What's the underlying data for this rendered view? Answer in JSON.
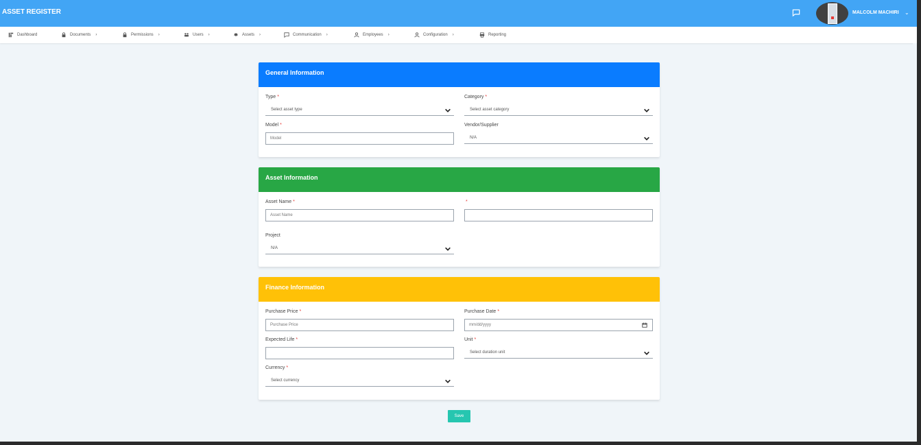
{
  "app": {
    "title": "ASSET REGISTER"
  },
  "topbar": {
    "chat_icon": "message-square-icon",
    "user_name": "MALCOLM MACHIRI",
    "user_caret": "⌄"
  },
  "nav": [
    {
      "label": "Dashboard",
      "icon": "dashboard-icon",
      "caret": ""
    },
    {
      "label": "Documents",
      "icon": "lock-icon",
      "caret": "›"
    },
    {
      "label": "Permissions",
      "icon": "lock-icon",
      "caret": "›"
    },
    {
      "label": "Users",
      "icon": "users-icon",
      "caret": "›"
    },
    {
      "label": "Assets",
      "icon": "car-icon",
      "caret": "›"
    },
    {
      "label": "Communication",
      "icon": "message-icon",
      "caret": "›"
    },
    {
      "label": "Employees",
      "icon": "user-icon",
      "caret": "›"
    },
    {
      "label": "Configuration",
      "icon": "user-icon",
      "caret": "›"
    },
    {
      "label": "Reporting",
      "icon": "printer-icon",
      "caret": ""
    }
  ],
  "required_marker": "*",
  "general": {
    "header": "General Information",
    "header_color": "#0a7cff",
    "type_label": "Type",
    "type_value": "Select asset type",
    "category_label": "Category",
    "category_value": "Select asset category",
    "model_label": "Model",
    "model_placeholder": "Model",
    "vendor_label": "Vendor/Supplier",
    "vendor_value": "N/A"
  },
  "asset": {
    "header": "Asset Information",
    "header_color": "#28a745",
    "name_label": "Asset Name",
    "name_placeholder": "Asset Name",
    "unnamed_label": "",
    "unnamed_value": "",
    "project_label": "Project",
    "project_value": "N/A"
  },
  "finance": {
    "header": "Finance Information",
    "header_color": "#ffc107",
    "price_label": "Purchase Price",
    "price_placeholder": "Purchase Price",
    "date_label": "Purchase Date",
    "date_placeholder": "mm/dd/yyyy",
    "life_label": "Expected Life",
    "life_value": "",
    "unit_label": "Unit",
    "unit_value": "Select duration unit",
    "currency_label": "Currency",
    "currency_value": "Select currency"
  },
  "actions": {
    "save_label": "Save",
    "save_color": "#26c6b0"
  }
}
